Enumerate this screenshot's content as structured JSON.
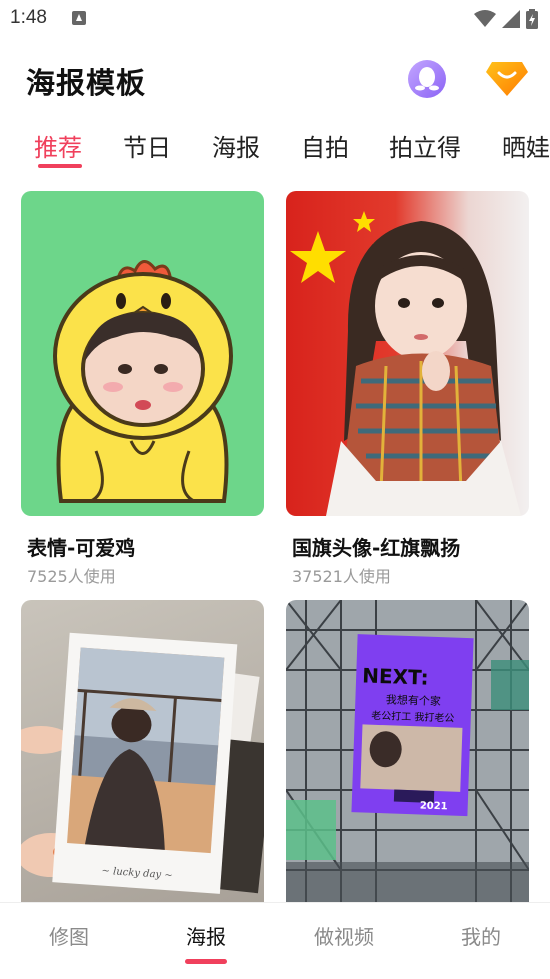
{
  "status_bar": {
    "time": "1:48",
    "icons": [
      "notification-a-icon",
      "wifi-icon",
      "signal-icon",
      "battery-icon"
    ]
  },
  "header": {
    "title": "海报模板",
    "icons": [
      "qq-icon",
      "vip-diamond-icon"
    ]
  },
  "tabs": [
    {
      "label": "推荐",
      "active": true
    },
    {
      "label": "节日",
      "active": false
    },
    {
      "label": "海报",
      "active": false
    },
    {
      "label": "自拍",
      "active": false
    },
    {
      "label": "拍立得",
      "active": false
    },
    {
      "label": "晒娃",
      "active": false
    }
  ],
  "templates": [
    {
      "title": "表情-可爱鸡",
      "usage": "7525人使用"
    },
    {
      "title": "国旗头像-红旗飘扬",
      "usage": "37521人使用"
    },
    {
      "title": "",
      "usage": "",
      "image_text": "lucky day"
    },
    {
      "title": "",
      "usage": "",
      "image_text": [
        "NEXT:",
        "我想有个家",
        "老公打工 我打老公",
        "2021"
      ]
    }
  ],
  "bottom_nav": [
    {
      "label": "修图",
      "active": false
    },
    {
      "label": "海报",
      "active": true
    },
    {
      "label": "做视频",
      "active": false
    },
    {
      "label": "我的",
      "active": false
    }
  ],
  "colors": {
    "accent": "#f0405c",
    "card1_bg": "#6dd68a",
    "card2_bg": "#d8231c",
    "qq_purple": "#8b63f5",
    "vip_orange": "#ff8a00"
  }
}
